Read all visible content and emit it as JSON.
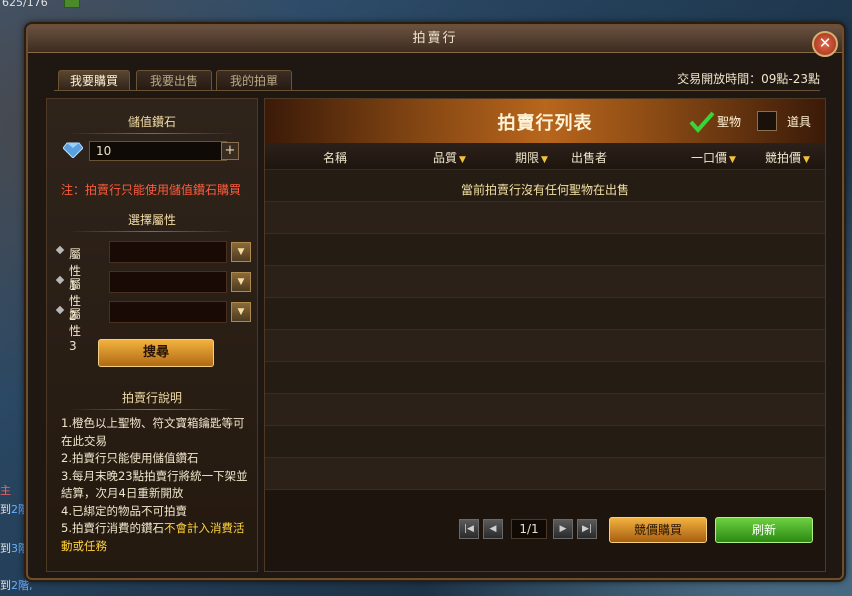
{
  "hud": {
    "counter": "625/176"
  },
  "side_notes": [
    "主",
    "到",
    "2階",
    "到",
    "3階",
    "到",
    "2階,"
  ],
  "window": {
    "title": "拍賣行",
    "close_icon": "close-icon"
  },
  "tabs": [
    {
      "label": "我要購買",
      "active": true
    },
    {
      "label": "我要出售",
      "active": false
    },
    {
      "label": "我的拍單",
      "active": false
    }
  ],
  "trade_time": "交易開放時間：09點-23點",
  "left": {
    "stone_heading": "儲值鑽石",
    "stone_value": "10",
    "stone_note": "注：拍賣行只能使用儲值鑽石購買",
    "attr_heading": "選擇屬性",
    "attrs": [
      "屬性1",
      "屬性2",
      "屬性3"
    ],
    "search_label": "搜尋",
    "help_heading": "拍賣行說明",
    "help": [
      "1.橙色以上聖物、符文寶箱鑰匙等可在此交易",
      "2.拍賣行只能使用儲值鑽石",
      "3.每月末晚23點拍賣行將統一下架並結算，次月4日重新開放",
      "4.已綁定的物品不可拍賣"
    ],
    "help5_a": "5.拍賣行消費的鑽石",
    "help5_b": "不會計入消費活動或任務"
  },
  "right": {
    "title": "拍賣行列表",
    "filter_holy": {
      "label": "聖物",
      "checked": true
    },
    "filter_item": {
      "label": "道具",
      "checked": false
    },
    "columns": [
      "名稱",
      "品質",
      "期限",
      "出售者",
      "一口價",
      "競拍價"
    ],
    "empty_message": "當前拍賣行沒有任何聖物在出售",
    "page": "1/1",
    "bid_label": "競價購買",
    "refresh_label": "刷新"
  },
  "colors": {
    "accent_orange": "#f2b240",
    "accent_green": "#2a8a14",
    "warn_red": "#ff5b3c"
  }
}
